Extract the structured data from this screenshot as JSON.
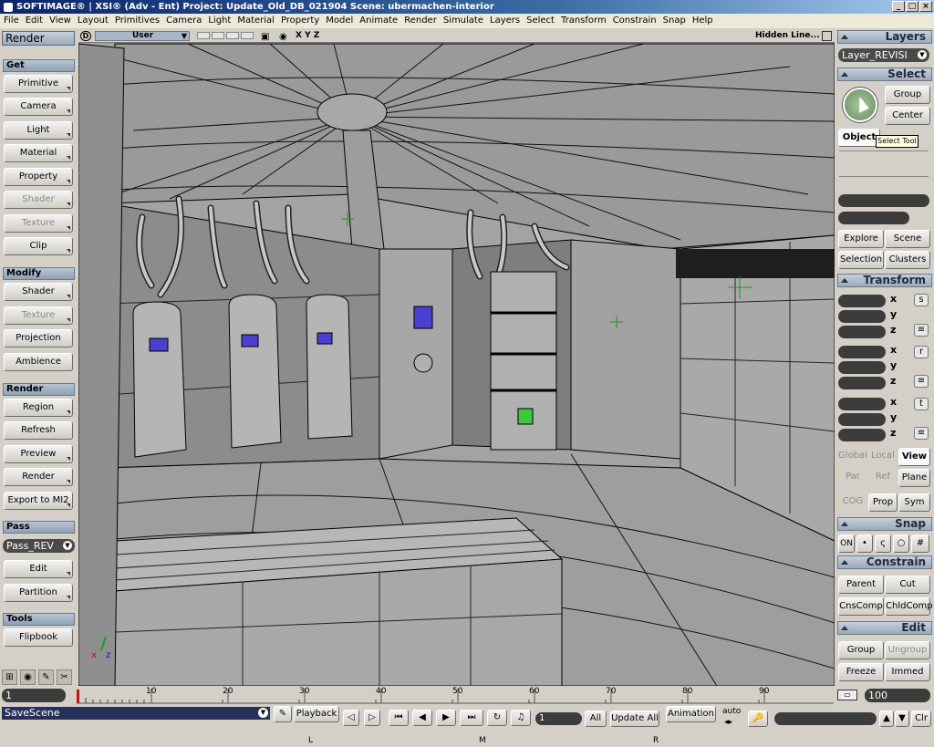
{
  "window": {
    "title": "SOFTIMAGE® | XSI® (Adv - Ent) Project: Update_Old_DB_021904    Scene: ubermachen-interior",
    "controls": [
      "_",
      "□",
      "×"
    ]
  },
  "menu": [
    "File",
    "Edit",
    "View",
    "Layout",
    "Primitives",
    "Camera",
    "Light",
    "Material",
    "Property",
    "Model",
    "Animate",
    "Render",
    "Simulate",
    "Layers",
    "Select",
    "Transform",
    "Constrain",
    "Snap",
    "Help"
  ],
  "left_panel": {
    "title": "Render",
    "sections": [
      {
        "header": "Get",
        "buttons": [
          {
            "label": "Primitive",
            "enabled": true
          },
          {
            "label": "Camera",
            "enabled": true
          },
          {
            "label": "Light",
            "enabled": true
          },
          {
            "label": "Material",
            "enabled": true
          },
          {
            "label": "Property",
            "enabled": true
          },
          {
            "label": "Shader",
            "enabled": false
          },
          {
            "label": "Texture",
            "enabled": false
          },
          {
            "label": "Clip",
            "enabled": true
          }
        ]
      },
      {
        "header": "Modify",
        "buttons": [
          {
            "label": "Shader",
            "enabled": true
          },
          {
            "label": "Texture",
            "enabled": false
          },
          {
            "label": "Projection",
            "enabled": true
          },
          {
            "label": "Ambience",
            "enabled": true
          }
        ]
      },
      {
        "header": "Render",
        "buttons": [
          {
            "label": "Region",
            "enabled": true
          },
          {
            "label": "Refresh",
            "enabled": true
          },
          {
            "label": "Preview",
            "enabled": true
          },
          {
            "label": "Render",
            "enabled": true
          },
          {
            "label": "Export to MI2",
            "enabled": true
          }
        ]
      },
      {
        "header": "Pass",
        "dropdown": "Pass_REV",
        "buttons": [
          {
            "label": "Edit",
            "enabled": true
          },
          {
            "label": "Partition",
            "enabled": true
          }
        ]
      },
      {
        "header": "Tools",
        "buttons": [
          {
            "label": "Flipbook",
            "enabled": true
          }
        ]
      }
    ]
  },
  "viewport": {
    "camera": "User",
    "axes_label": "X Y Z",
    "display_mode": "Hidden Line..."
  },
  "right_panel": {
    "layers_header": "Layers",
    "layer_value": "Layer_REVISI",
    "select_header": "Select",
    "select_buttons": {
      "group": "Group",
      "center": "Center",
      "object": "Object",
      "explore": "Explore",
      "scene": "Scene",
      "selection": "Selection",
      "clusters": "Clusters"
    },
    "tooltip": "Select Tool",
    "transform_header": "Transform",
    "axis_labels": [
      "x",
      "y",
      "z"
    ],
    "transform_icons": [
      "s",
      "r",
      "t"
    ],
    "space_buttons": {
      "global": "Global",
      "local": "Local",
      "view": "View",
      "par": "Par",
      "ref": "Ref",
      "plane": "Plane",
      "cog": "COG",
      "prop": "Prop",
      "sym": "Sym"
    },
    "snap_header": "Snap",
    "snap_on": "ON",
    "constrain_header": "Constrain",
    "constrain_buttons": [
      "Parent",
      "Cut",
      "CnsComp",
      "ChldComp"
    ],
    "edit_header": "Edit",
    "edit_buttons": [
      {
        "label": "Group",
        "enabled": true
      },
      {
        "label": "Ungroup",
        "enabled": false
      },
      {
        "label": "Freeze",
        "enabled": true
      },
      {
        "label": "Immed",
        "enabled": true
      }
    ]
  },
  "timeline": {
    "current_frame": "1",
    "end_frame": "100",
    "ticks": [
      "10",
      "20",
      "30",
      "40",
      "50",
      "60",
      "70",
      "80",
      "90"
    ]
  },
  "bottom_bar": {
    "command": "SaveScene",
    "playback_label": "Playback",
    "frame_field": "1",
    "all_label": "All",
    "update_all": "Update All",
    "animation_label": "Animation",
    "auto_label": "auto",
    "clr_label": "Clr",
    "mouse_labels": [
      "L",
      "M",
      "R"
    ]
  }
}
